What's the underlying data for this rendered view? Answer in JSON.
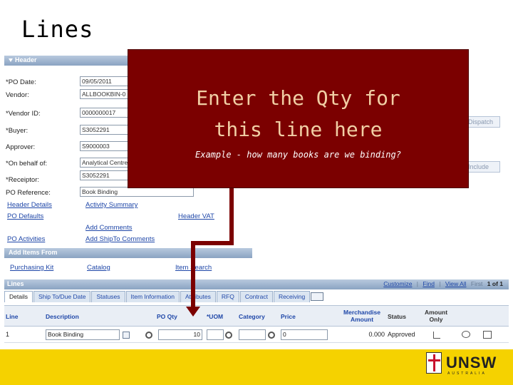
{
  "slide_title": "Lines",
  "header_section": {
    "title": "Header",
    "fields": [
      {
        "label": "*PO Date:",
        "value": "09/05/2011"
      },
      {
        "label": "Vendor:",
        "value": "ALLBOOKBIN-0"
      },
      {
        "label": "*Vendor ID:",
        "value": "0000000017"
      },
      {
        "label": "*Buyer:",
        "value": "S3052291"
      },
      {
        "label": "Approver:",
        "value": "S9000003"
      },
      {
        "label": "*On behalf of:",
        "value": "Analytical Centre"
      },
      {
        "label": "*Receiptor:",
        "value": "S3052291"
      },
      {
        "label": "PO Reference:",
        "value": "Book Binding"
      }
    ],
    "right_buttons": [
      "Dispatch",
      "Include"
    ],
    "links_col1": [
      "Header Details",
      "PO Defaults",
      "PO Activities"
    ],
    "links_col2": [
      "Activity Summary",
      "Add Comments",
      "Add ShipTo Comments"
    ],
    "links_col3": [
      "Header VAT"
    ]
  },
  "add_items": {
    "title": "Add Items From",
    "links": [
      "Purchasing Kit",
      "Catalog",
      "Item Search"
    ]
  },
  "lines": {
    "title": "Lines",
    "nav": {
      "customize": "Customize",
      "find": "Find",
      "view_all": "View All",
      "first": "First",
      "count": "1 of 1"
    },
    "tabs": [
      "Details",
      "Ship To/Due Date",
      "Statuses",
      "Item Information",
      "Attributes",
      "RFQ",
      "Contract",
      "Receiving"
    ],
    "columns": {
      "line": "Line",
      "description": "Description",
      "po_qty": "PO Qty",
      "uom": "*UOM",
      "category": "Category",
      "price": "Price",
      "merchandise_amount": "Merchandise Amount",
      "status": "Status",
      "amount_only": "Amount Only"
    },
    "rows": [
      {
        "line": "1",
        "description": "Book Binding",
        "po_qty": "10",
        "uom": "",
        "category": "",
        "price": "0",
        "merchandise_amount": "0.000",
        "status": "Approved"
      }
    ]
  },
  "callout": {
    "headline_line1": "Enter the Qty for",
    "headline_line2": "this line here",
    "example": "Example - how many books are we binding?",
    "color": "#7b0000",
    "text_color": "#f1cfa5"
  },
  "footer": {
    "brand": "UNSW",
    "brand_sub": "AUSTRALIA",
    "color": "#f5d200"
  }
}
